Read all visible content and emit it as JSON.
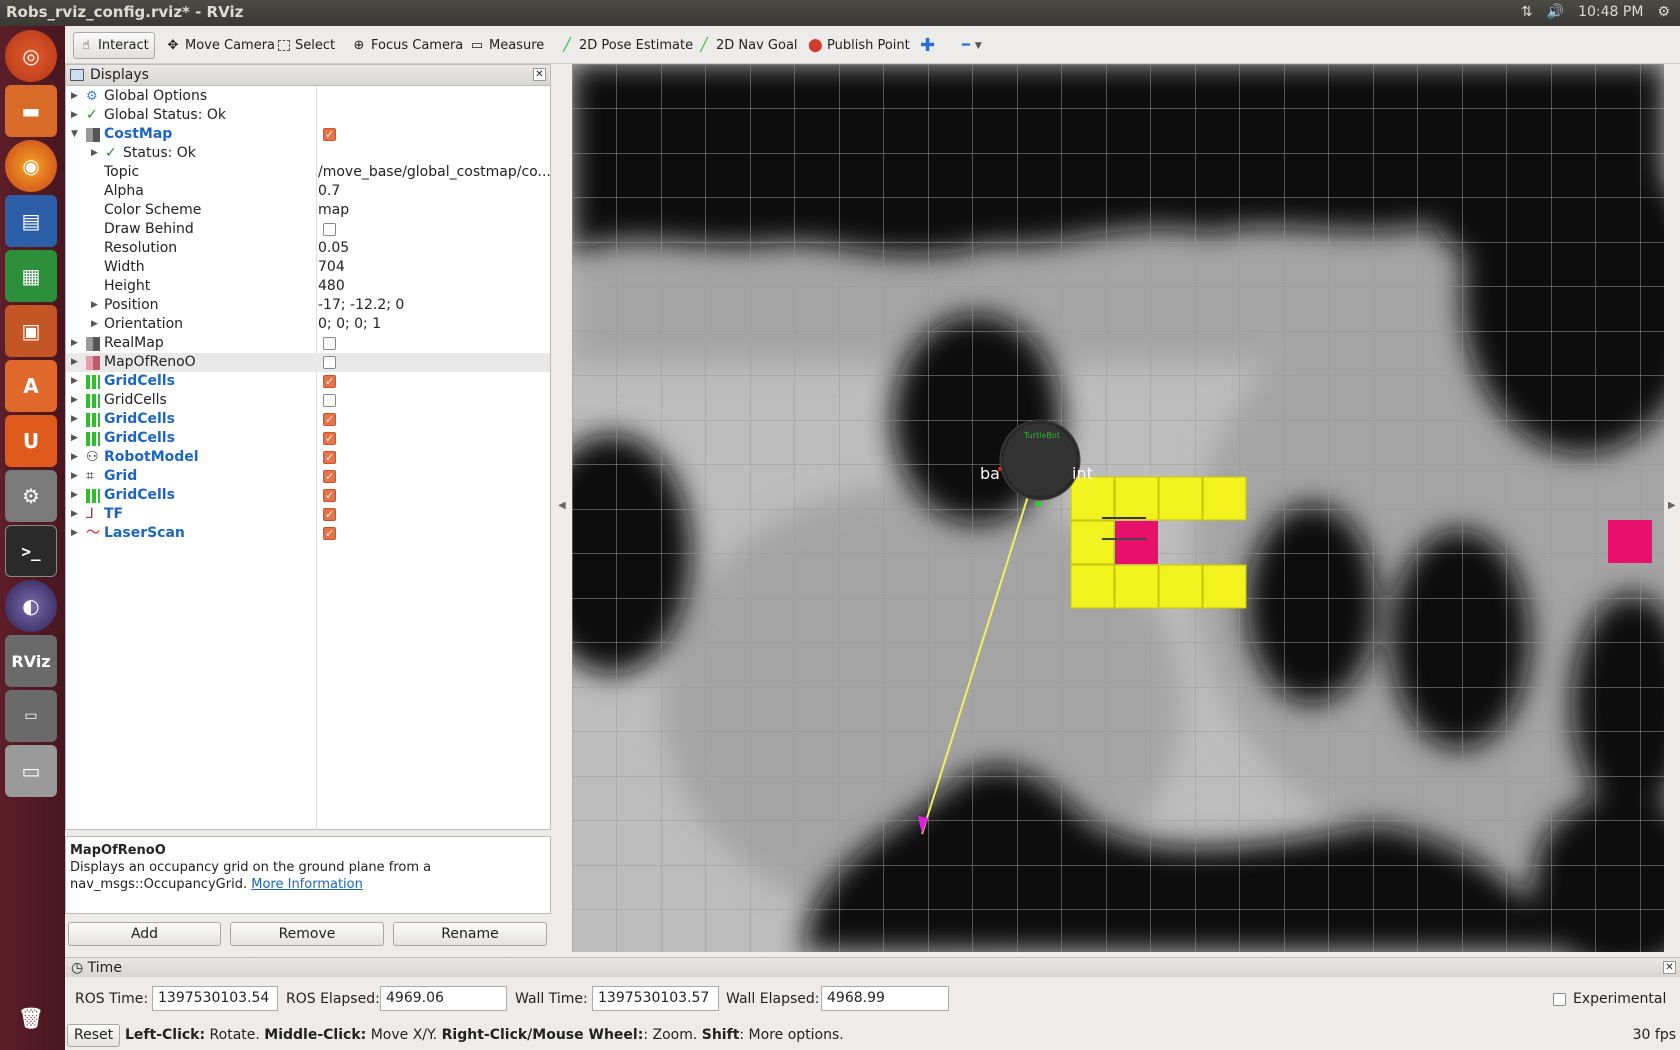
{
  "window": {
    "title": "Robs_rviz_config.rviz* - RViz",
    "clock": "10:48 PM"
  },
  "toolbar": {
    "interact": "Interact",
    "move_camera": "Move Camera",
    "select": "Select",
    "focus_camera": "Focus Camera",
    "measure": "Measure",
    "pose_estimate": "2D Pose Estimate",
    "nav_goal": "2D Nav Goal",
    "publish_point": "Publish Point"
  },
  "displays": {
    "title": "Displays",
    "rows": [
      {
        "label": "Global Options"
      },
      {
        "label": "Global Status: Ok"
      },
      {
        "label": "CostMap"
      },
      {
        "label": "Status: Ok"
      },
      {
        "label": "Topic",
        "value": "/move_base/global_costmap/co..."
      },
      {
        "label": "Alpha",
        "value": "0.7"
      },
      {
        "label": "Color Scheme",
        "value": "map"
      },
      {
        "label": "Draw Behind"
      },
      {
        "label": "Resolution",
        "value": "0.05"
      },
      {
        "label": "Width",
        "value": "704"
      },
      {
        "label": "Height",
        "value": "480"
      },
      {
        "label": "Position",
        "value": "-17; -12.2; 0"
      },
      {
        "label": "Orientation",
        "value": "0; 0; 0; 1"
      },
      {
        "label": "RealMap"
      },
      {
        "label": "MapOfRenoO"
      },
      {
        "label": "GridCells"
      },
      {
        "label": "GridCells"
      },
      {
        "label": "GridCells"
      },
      {
        "label": "GridCells"
      },
      {
        "label": "RobotModel"
      },
      {
        "label": "Grid"
      },
      {
        "label": "GridCells"
      },
      {
        "label": "TF"
      },
      {
        "label": "LaserScan"
      }
    ]
  },
  "description": {
    "title": "MapOfRenoO",
    "text": "Displays an occupancy grid on the ground plane from a nav_msgs::OccupancyGrid.",
    "link": "More Information"
  },
  "buttons": {
    "add": "Add",
    "remove": "Remove",
    "rename": "Rename"
  },
  "time": {
    "title": "Time",
    "ros_time_label": "ROS Time:",
    "ros_time": "1397530103.54",
    "ros_elapsed_label": "ROS Elapsed:",
    "ros_elapsed": "4969.06",
    "wall_time_label": "Wall Time:",
    "wall_time": "1397530103.57",
    "wall_elapsed_label": "Wall Elapsed:",
    "wall_elapsed": "4968.99",
    "experimental": "Experimental"
  },
  "status": {
    "reset": "Reset",
    "k1": "Left-Click:",
    "v1": " Rotate. ",
    "k2": "Middle-Click:",
    "v2": " Move X/Y. ",
    "k3": "Right-Click/Mouse Wheel:",
    "v3": ": Zoom. ",
    "k4": "Shift",
    "v4": ": More options.",
    "fps": "30 fps"
  },
  "viewport": {
    "frame_label_left": "ba",
    "frame_label_right": "int"
  }
}
